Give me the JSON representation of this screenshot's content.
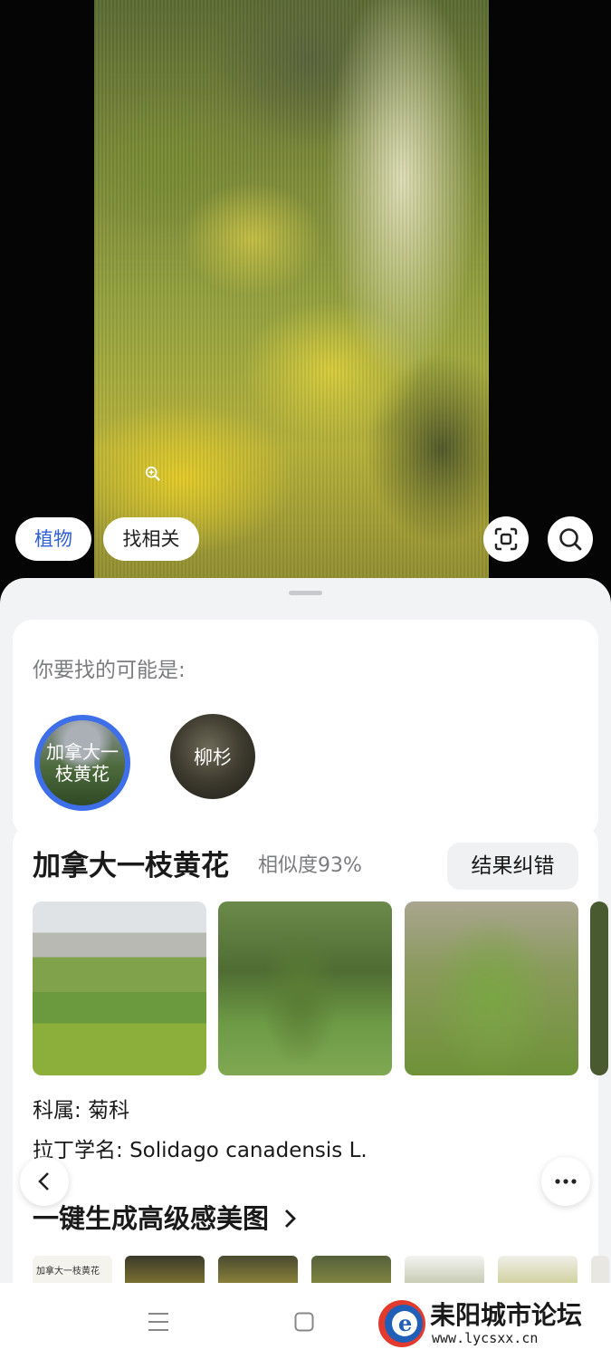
{
  "camera": {
    "chips": {
      "plant": "植物",
      "related": "找相关"
    }
  },
  "sheet": {
    "suggest": {
      "title": "你要找的可能是:",
      "candidates": [
        {
          "line1": "加拿大一",
          "line2": "枝黄花",
          "selected": true
        },
        {
          "label": "柳杉",
          "selected": false
        }
      ]
    },
    "result": {
      "name": "加拿大一枝黄花",
      "similarity": "相似度93%",
      "correct_button": "结果纠错",
      "family_label": "科属:",
      "family_value": "菊科",
      "latin_label": "拉丁学名:",
      "latin_value": "Solidago canadensis  L.",
      "beautify": "一键生成高级感美图",
      "mini_caption": "加拿大一枝黄花"
    }
  },
  "watermark": {
    "name": "耒阳城市论坛",
    "url": "www.lycsxx.cn"
  },
  "colors": {
    "accent": "#3e6ee8",
    "sheet_bg": "#f2f3f5"
  }
}
